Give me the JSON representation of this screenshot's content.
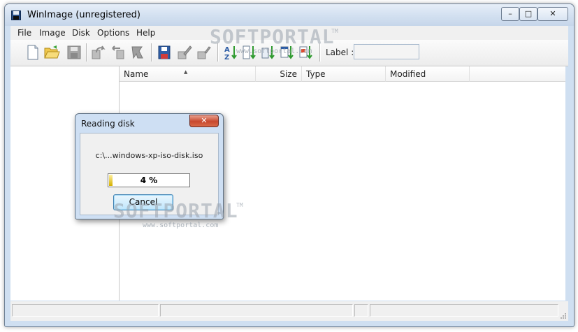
{
  "window": {
    "title": "WinImage (unregistered)"
  },
  "menu": [
    {
      "label": "File"
    },
    {
      "label": "Image"
    },
    {
      "label": "Disk"
    },
    {
      "label": "Options"
    },
    {
      "label": "Help"
    }
  ],
  "toolbar": {
    "label_text": "Label :",
    "label_value": ""
  },
  "columns": [
    {
      "label": "Name"
    },
    {
      "label": "Size"
    },
    {
      "label": "Type"
    },
    {
      "label": "Modified"
    }
  ],
  "dialog": {
    "title": "Reading disk",
    "close_glyph": "✕",
    "file": "c:\\...windows-xp-iso-disk.iso",
    "progress_text": "4 %",
    "progress_percent": 4,
    "cancel_label": "Cancel"
  },
  "watermark": {
    "brand_top": "SOFTPORTAL",
    "tm_top": "TM",
    "url_top": "www.softportal.com",
    "brand": "SOFTPORTAL",
    "tm": "TM",
    "url": "www.softportal.com"
  },
  "colors": {
    "accent": "#3c7fb1",
    "close_red": "#c8482e",
    "progress": "#d4b000"
  }
}
